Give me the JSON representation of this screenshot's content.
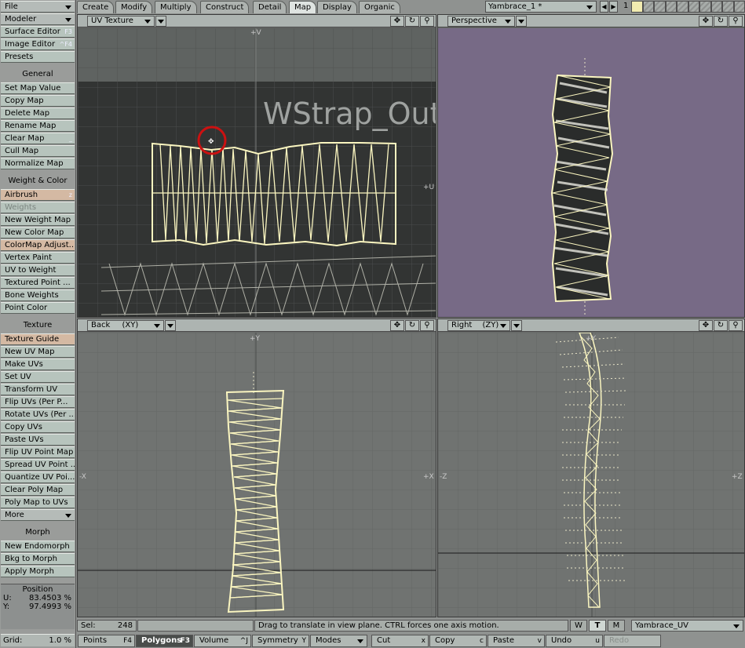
{
  "sidebar": {
    "file": "File",
    "modeler": "Modeler",
    "surface_editor": {
      "label": "Surface Editor",
      "key": "F3"
    },
    "image_editor": {
      "label": "Image Editor",
      "key": "^F4"
    },
    "presets": "Presets",
    "general_header": "General",
    "general": [
      "Set Map Value",
      "Copy Map",
      "Delete Map",
      "Rename Map",
      "Clear Map",
      "Cull Map",
      "Normalize Map"
    ],
    "clear_map_key": "_",
    "weight_color_header": "Weight & Color",
    "airbrush": {
      "label": "Airbrush",
      "key": "z"
    },
    "weights": "Weights",
    "weight_color": [
      "New Weight Map",
      "New Color Map",
      "ColorMap Adjust...",
      "Vertex Paint",
      "UV to Weight",
      "Textured Point ...",
      "Bone Weights",
      "Point Color"
    ],
    "texture_header": "Texture",
    "texture_guide": "Texture Guide",
    "texture": [
      "New UV Map",
      "Make UVs",
      "Set UV",
      "Transform UV",
      "Flip UVs (Per P...",
      "Rotate UVs (Per ...",
      "Copy UVs",
      "Paste UVs",
      "Flip UV Point Map",
      "Spread UV Point ...",
      "Quantize UV Poi...",
      "Clear Poly Map",
      "Poly Map to UVs"
    ],
    "more": "More",
    "morph_header": "Morph",
    "morph": [
      "New Endomorph",
      "Bkg to Morph",
      "Apply Morph"
    ],
    "position": {
      "title": "Position",
      "u_label": "U:",
      "u_value": "83.4503 %",
      "v_label": "Y:",
      "v_value": "97.4993 %"
    },
    "grid": {
      "label": "Grid:",
      "value": "1.0 %"
    }
  },
  "tabs": [
    "Create",
    "Modify",
    "Multiply",
    "Construct",
    "Detail",
    "Map",
    "Display",
    "Organic"
  ],
  "active_tab": "Map",
  "object": {
    "name": "Yambrace_1  *",
    "layer_number": "1"
  },
  "viewports": {
    "top_left": {
      "view": "UV Texture",
      "axis_top": "+V",
      "axis_right": "+U",
      "overlay_text": "WStrap_Oute"
    },
    "top_right": {
      "view": "Perspective"
    },
    "bottom_left": {
      "view": "Back",
      "plane": "(XY)",
      "axis_top": "+Y",
      "axis_left": "-X",
      "axis_right": "+X"
    },
    "bottom_right": {
      "view": "Right",
      "plane": "(ZY)",
      "axis_top": "+Y",
      "axis_left": "-Z",
      "axis_right": "+Z"
    }
  },
  "status": {
    "sel_label": "Sel:",
    "sel_count": "248",
    "message": "Drag to translate in view plane. CTRL forces one axis motion.",
    "w": "W",
    "t": "T",
    "m": "M",
    "vmap": "Yambrace_UV"
  },
  "toolbar": {
    "points": {
      "label": "Points",
      "key": "F4"
    },
    "polygons": {
      "label": "Polygons",
      "key": "F3"
    },
    "volume": {
      "label": "Volume",
      "key": "^J"
    },
    "symmetry": {
      "label": "Symmetry",
      "key": "Y"
    },
    "modes": "Modes",
    "cut": {
      "label": "Cut",
      "key": "x"
    },
    "copy": {
      "label": "Copy",
      "key": "c"
    },
    "paste": {
      "label": "Paste",
      "key": "v"
    },
    "undo": {
      "label": "Undo",
      "key": "u"
    },
    "redo": "Redo"
  },
  "colors": {
    "accent_tab": "#dfe4e1",
    "perspective_bg": "#776a86",
    "wire": "#fbf6c0",
    "highlight": "#cc1111"
  }
}
